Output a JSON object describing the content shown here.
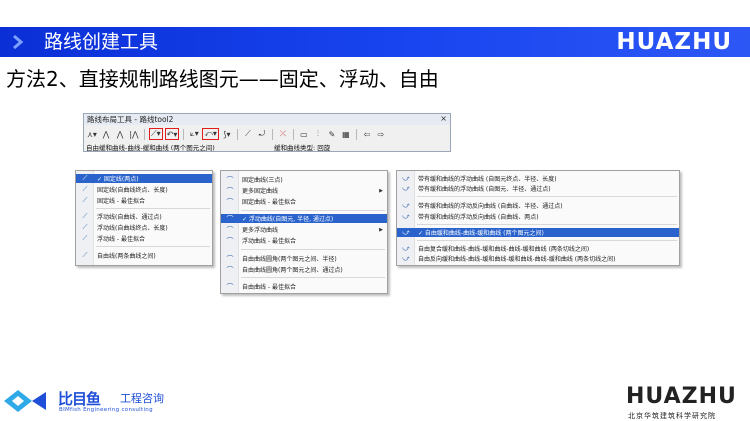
{
  "header": {
    "title": "路线创建工具",
    "logo": "HUAZHU",
    "bg_color": "#1845f0"
  },
  "subtitle": "方法2、直接规制路线图元——固定、浮动、自由",
  "toolbar": {
    "window_title": "路线布局工具 - 路线tool2",
    "close": "×",
    "status_left": "自由缓和曲线-曲线-缓和曲线 (两个图元之间)",
    "status_right": "缓和曲线类型: 回旋",
    "highlight_color": "#e21b1b"
  },
  "menu1": {
    "items": [
      {
        "icon": "line-icon",
        "label": "固定线(两点)",
        "selected": true
      },
      {
        "icon": "line-icon",
        "label": "固定线(自曲线终点、长度)"
      },
      {
        "icon": "line-icon",
        "label": "固定线 - 最佳拟合"
      },
      {
        "icon": "line-icon",
        "label": "浮动线(自曲线、通过点)"
      },
      {
        "icon": "line-icon",
        "label": "浮动线(自曲线终点、长度)"
      },
      {
        "icon": "line-icon",
        "label": "浮动线 - 最佳拟合"
      },
      {
        "icon": "line-icon",
        "label": "自由线(两条曲线之间)"
      }
    ]
  },
  "menu2": {
    "items": [
      {
        "icon": "curve-icon",
        "label": "固定曲线(三点)"
      },
      {
        "icon": "curve-icon",
        "label": "更多固定曲线",
        "submenu": true
      },
      {
        "icon": "curve-icon",
        "label": "固定曲线 - 最佳拟合"
      },
      {
        "icon": "curve-icon",
        "label": "浮动曲线(自图元, 半径, 通过点)",
        "selected": true
      },
      {
        "icon": "curve-icon",
        "label": "更多浮动曲线",
        "submenu": true
      },
      {
        "icon": "curve-icon",
        "label": "浮动曲线 - 最佳拟合"
      },
      {
        "icon": "curve-icon",
        "label": "自由曲线圆角(两个图元之间、半径)"
      },
      {
        "icon": "curve-icon",
        "label": "自由曲线圆角(两个图元之间、通过点)"
      },
      {
        "icon": "curve-icon",
        "label": "自由曲线 - 最佳拟合"
      }
    ]
  },
  "menu3": {
    "items": [
      {
        "icon": "spiral-icon",
        "label": "带有缓和曲线的浮动曲线 (自图元终点、半径、长度)"
      },
      {
        "icon": "spiral-icon",
        "label": "带有缓和曲线的浮动曲线 (自图元、半径、通过点)"
      },
      {
        "icon": "spiral-icon",
        "label": "带有缓和曲线的浮动反向曲线 (自曲线、半径、通过点)"
      },
      {
        "icon": "spiral-icon",
        "label": "带有缓和曲线的浮动反向曲线 (自曲线、两点)"
      },
      {
        "icon": "spiral-icon",
        "label": "自由缓和曲线-曲线-缓和曲线 (两个图元之间)",
        "selected": true
      },
      {
        "icon": "spiral-icon",
        "label": "自由复合缓和曲线-曲线-缓和曲线-曲线-缓和曲线 (两条切线之间)"
      },
      {
        "icon": "spiral-icon",
        "label": "自由反向缓和曲线-曲线-缓和曲线-缓和曲线-曲线-缓和曲线 (两条切线之间)"
      }
    ]
  },
  "footer": {
    "bim_cn1": "比目鱼",
    "bim_cn2": "工程咨询",
    "bim_en": "BIMfish Engineering consulting",
    "huazhu": "HUAZHU",
    "huazhu_cn": "北京华筑建筑科学研究院"
  }
}
